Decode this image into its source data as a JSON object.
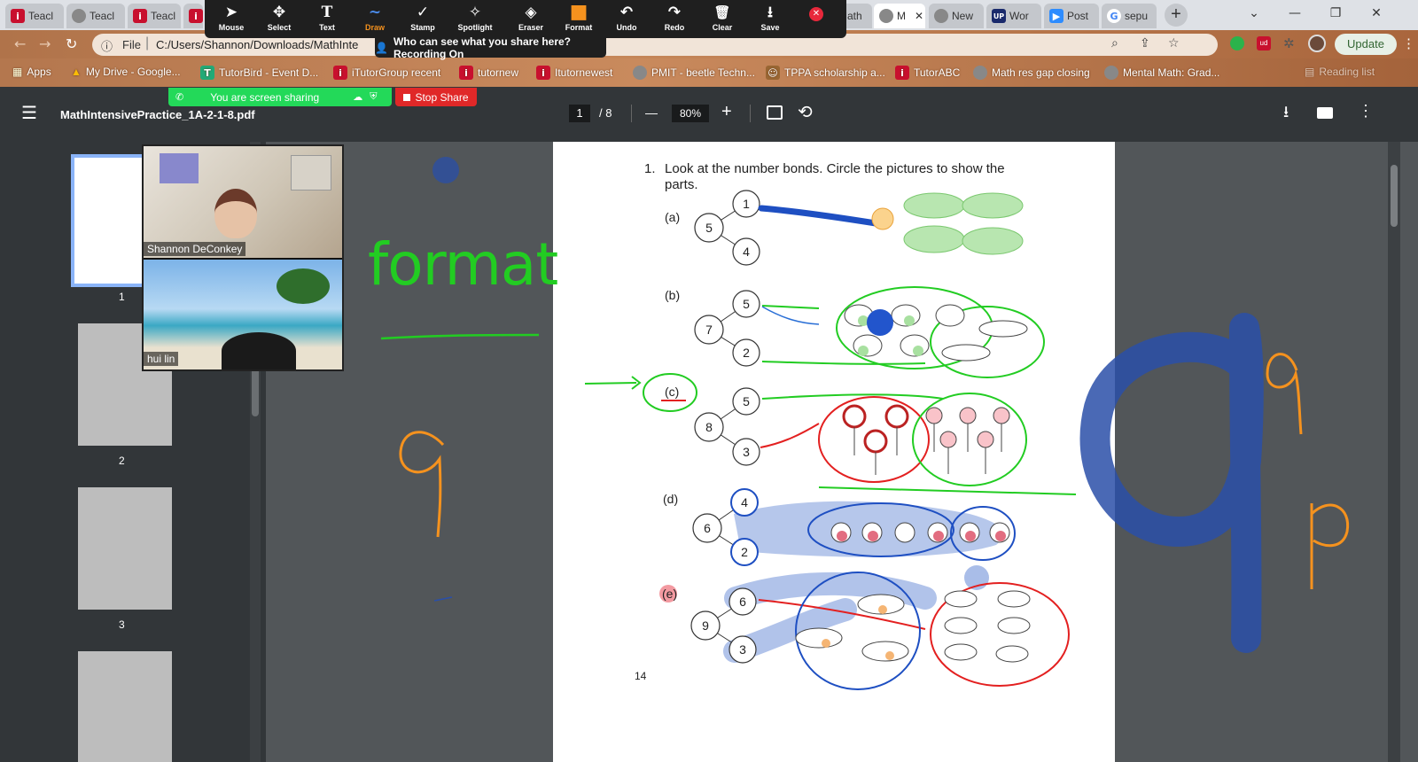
{
  "tabs": [
    {
      "label": "Teacl",
      "icon": "itutor-icon"
    },
    {
      "label": "Teacl",
      "icon": "globe-icon"
    },
    {
      "label": "Teacl",
      "icon": "itutor-icon"
    },
    {
      "label": "",
      "icon": "itutor-icon"
    },
    {
      "label": "Math",
      "icon": ""
    },
    {
      "label": "M",
      "icon": "globe-icon"
    },
    {
      "label": "New",
      "icon": "chrome-icon"
    },
    {
      "label": "Wor",
      "icon": "word-icon"
    },
    {
      "label": "Post",
      "icon": "zoom-icon"
    },
    {
      "label": "sepu",
      "icon": "google-icon"
    }
  ],
  "window_controls": {
    "minimize": "—",
    "restore": "❐",
    "close": "✕",
    "dropdown": "⌄"
  },
  "address": {
    "scheme": "File",
    "url": "C:/Users/Shannon/Downloads/MathInte",
    "update": "Update"
  },
  "bookmarks": [
    {
      "label": "Apps"
    },
    {
      "label": "My Drive - Google..."
    },
    {
      "label": "TutorBird - Event D..."
    },
    {
      "label": "iTutorGroup recent"
    },
    {
      "label": "tutornew"
    },
    {
      "label": "Itutornewest"
    },
    {
      "label": "PMIT - beetle Techn..."
    },
    {
      "label": "TPPA scholarship a..."
    },
    {
      "label": "TutorABC"
    },
    {
      "label": "Math res gap closing"
    },
    {
      "label": "Mental Math: Grad..."
    },
    {
      "label": "Reading list"
    }
  ],
  "annotate_tools": [
    {
      "label": "Mouse",
      "icon": "cursor-icon",
      "glyph": "➤"
    },
    {
      "label": "Select",
      "icon": "move-icon",
      "glyph": "✥"
    },
    {
      "label": "Text",
      "icon": "text-icon",
      "glyph": "T"
    },
    {
      "label": "Draw",
      "icon": "draw-icon",
      "glyph": "∼"
    },
    {
      "label": "Stamp",
      "icon": "check-icon",
      "glyph": "✓"
    },
    {
      "label": "Spotlight",
      "icon": "wand-icon",
      "glyph": "✧"
    },
    {
      "label": "Eraser",
      "icon": "eraser-icon",
      "glyph": "◈"
    },
    {
      "label": "Format",
      "icon": "format-icon",
      "glyph": "■"
    },
    {
      "label": "Undo",
      "icon": "undo-icon",
      "glyph": "↶"
    },
    {
      "label": "Redo",
      "icon": "redo-icon",
      "glyph": "↷"
    },
    {
      "label": "Clear",
      "icon": "trash-icon",
      "glyph": "🗑"
    },
    {
      "label": "Save",
      "icon": "save-icon",
      "glyph": "⭳"
    }
  ],
  "share_notice": "Who can see what you share here? Recording On",
  "screen_sharing": "You are screen sharing",
  "stop_share": "Stop Share",
  "pdf": {
    "filename": "MathIntensivePractice_1A-2-1-8.pdf",
    "page": "1",
    "total": "/  8",
    "zoom": "80%",
    "minus": "—",
    "plus": "+"
  },
  "thumbnails": [
    "1",
    "2",
    "3"
  ],
  "participants": [
    {
      "name": "Shannon DeConkey"
    },
    {
      "name": "hui lin"
    }
  ],
  "page_content": {
    "question_num": "1.",
    "question_line1": "Look at the number bonds. Circle the pictures to show the",
    "question_line2": "parts.",
    "page_number": "14",
    "bonds": [
      {
        "label": "(a)",
        "whole": "5",
        "parts": [
          "1",
          "4"
        ]
      },
      {
        "label": "(b)",
        "whole": "7",
        "parts": [
          "5",
          "2"
        ]
      },
      {
        "label": "(c)",
        "whole": "8",
        "parts": [
          "5",
          "3"
        ]
      },
      {
        "label": "(d)",
        "whole": "6",
        "parts": [
          "4",
          "2"
        ]
      },
      {
        "label": "(e)",
        "whole": "9",
        "parts": [
          "6",
          "3"
        ]
      }
    ]
  },
  "annotations": {
    "format": "format",
    "nine_left": "9",
    "nine_right": "9",
    "p": "p"
  },
  "colors": {
    "green": "#22cc22",
    "orange": "#f5921e",
    "blue": "#2a4fa8",
    "red": "#e32020",
    "tool_bg": "#1f1f1f"
  }
}
